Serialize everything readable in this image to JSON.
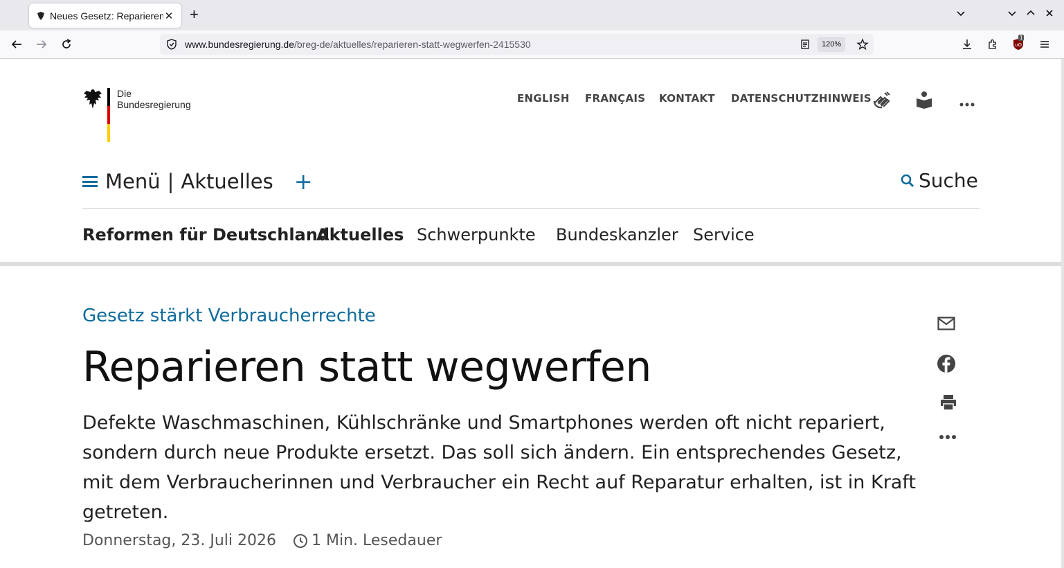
{
  "browser": {
    "tab_title": "Neues Gesetz: Reparieren",
    "url_domain": "www.bundesregierung.de",
    "url_path": "/breg-de/aktuelles/reparieren-statt-wegwerfen-2415530",
    "zoom": "120%",
    "extension_badge": "1"
  },
  "site": {
    "logo_line1": "Die",
    "logo_line2": "Bundesregierung",
    "flag_colors": [
      "#000000",
      "#dd0000",
      "#ffce00"
    ],
    "top_links": [
      "ENGLISH",
      "FRANÇAIS",
      "KONTAKT",
      "DATENSCHUTZHINWEIS"
    ],
    "menu_label": "Menü",
    "menu_separator": "|",
    "section_label": "Aktuelles",
    "plus": "+",
    "search_label": "Suche",
    "main_nav": [
      "Reformen für Deutschland",
      "Aktuelles",
      "Schwerpunkte",
      "Bundeskanzler",
      "Service"
    ],
    "accent_color": "#0f6c9c"
  },
  "article": {
    "kicker": "Gesetz stärkt Verbraucherrechte",
    "headline": "Reparieren statt wegwerfen",
    "lead": "Defekte Waschmaschinen, Kühlschränke und Smartphones werden oft nicht repariert, sondern durch neue Produkte ersetzt. Das soll sich ändern. Ein entsprechendes Gesetz, mit dem Verbraucherinnen und Verbraucher ein Recht auf Reparatur erhalten, ist in Kraft getreten.",
    "date": "Donnerstag, 23. Juli 2026",
    "reading_time": "1 Min. Lesedauer"
  }
}
